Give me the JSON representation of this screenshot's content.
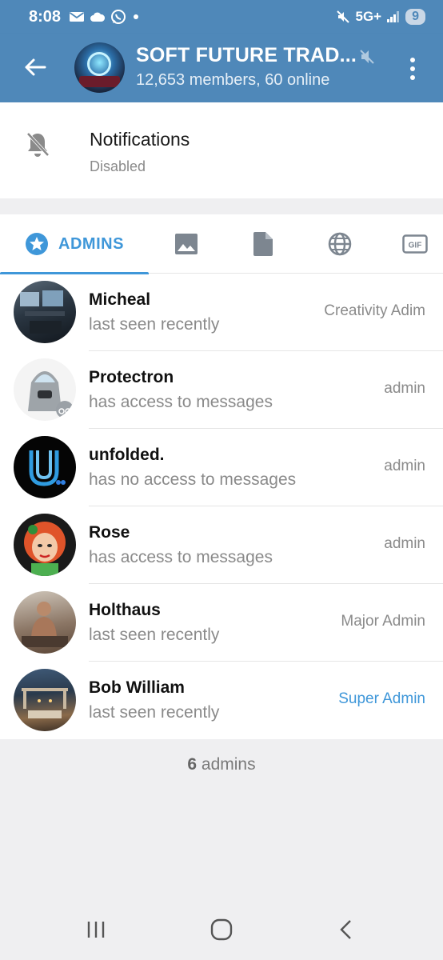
{
  "status_bar": {
    "time": "8:08",
    "network": "5G+",
    "battery": "9"
  },
  "header": {
    "title": "SOFT FUTURE TRAD...",
    "subtitle": "12,653 members, 60 online"
  },
  "notifications": {
    "title": "Notifications",
    "status": "Disabled"
  },
  "tabs": {
    "active_label": "ADMINS",
    "items": [
      "admins",
      "media",
      "files",
      "links",
      "gifs"
    ]
  },
  "admins": [
    {
      "name": "Micheal",
      "status": "last seen recently",
      "rank": "Creativity Adim"
    },
    {
      "name": "Protectron",
      "status": "has access to messages",
      "rank": "admin"
    },
    {
      "name": "unfolded.",
      "status": "has no access to messages",
      "rank": "admin"
    },
    {
      "name": "Rose",
      "status": "has access to messages",
      "rank": "admin"
    },
    {
      "name": "Holthaus",
      "status": "last seen recently",
      "rank": "Major Admin"
    },
    {
      "name": "Bob William",
      "status": "last seen recently",
      "rank": "Super Admin"
    }
  ],
  "footer": {
    "count": "6",
    "label": " admins"
  },
  "colors": {
    "header_blue": "#4f88b9",
    "accent": "#3f97d9"
  }
}
